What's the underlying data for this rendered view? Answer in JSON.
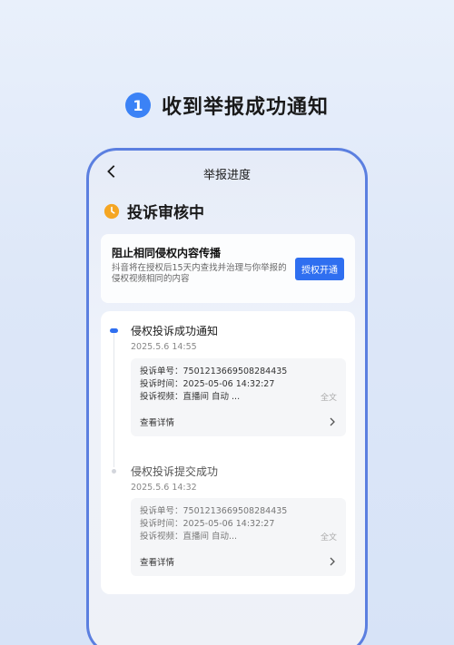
{
  "step": {
    "number": "1",
    "title": "收到举报成功通知"
  },
  "nav": {
    "title": "举报进度"
  },
  "status": {
    "text": "投诉审核中",
    "icon": "clock-icon",
    "icon_color": "#f5a623"
  },
  "promo": {
    "title": "阻止相同侵权内容传播",
    "desc": "抖音将在授权后15天内查找并治理与你举报的侵权视频相同的内容",
    "button": "授权开通"
  },
  "events": [
    {
      "title": "侵权投诉成功通知",
      "time": "2025.5.6 14:55",
      "lines": [
        "投诉单号：7501213669508284435",
        "投诉时间：2025-05-06 14:32:27",
        "投诉视频：直播间 自动 ..."
      ],
      "fulltext": "全文",
      "view": "查看详情"
    },
    {
      "title": "侵权投诉提交成功",
      "time": "2025.5.6 14:32",
      "lines": [
        "投诉单号：7501213669508284435",
        "投诉时间：2025-05-06 14:32:27",
        "投诉视频：直播间 自动..."
      ],
      "fulltext": "全文",
      "view": "查看详情"
    }
  ],
  "colors": {
    "accent": "#2f6ff0",
    "frame": "#5b7fe0",
    "step_badge": "#3b82f6"
  }
}
